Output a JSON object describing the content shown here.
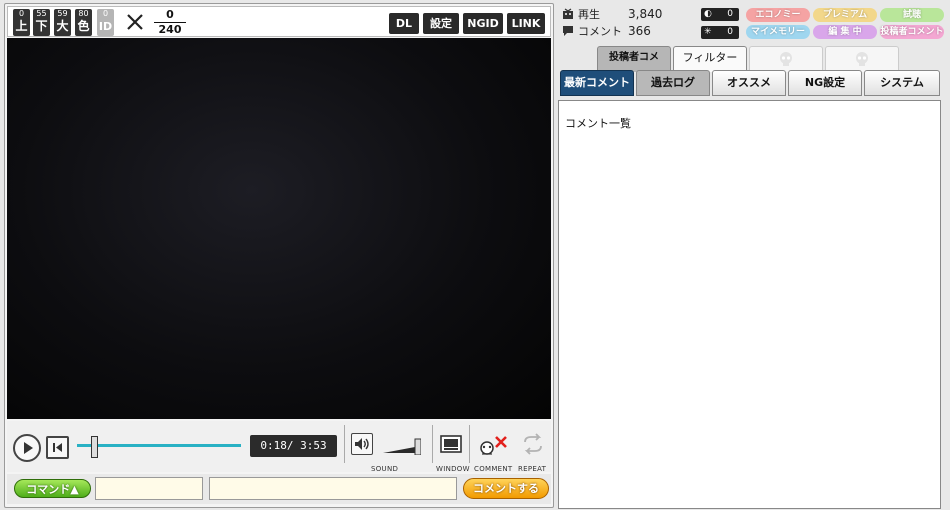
{
  "topbar": {
    "counters": [
      {
        "num": "0",
        "label": "上",
        "disabled": false
      },
      {
        "num": "55",
        "label": "下",
        "disabled": false
      },
      {
        "num": "59",
        "label": "大",
        "disabled": false
      },
      {
        "num": "80",
        "label": "色",
        "disabled": false
      },
      {
        "num": "0",
        "label": "ID",
        "disabled": true
      }
    ],
    "count_top": "0",
    "count_bottom": "240",
    "buttons": [
      "DL",
      "設定",
      "NGID",
      "LINK"
    ]
  },
  "player": {
    "time_display": "0:18/ 3:53",
    "seek_progress": 0.08,
    "volume_level": 1.0,
    "labels": {
      "sound": "SOUND",
      "window": "WINDOW",
      "comment": "COMMENT",
      "repeat": "REPEAT"
    }
  },
  "comment_bar": {
    "command_button": "コマンド▲",
    "command_value": "",
    "comment_value": "",
    "send_button": "コメントする"
  },
  "stats": {
    "views_label": "再生",
    "views_value": "3,840",
    "comments_label": "コメント",
    "comments_value": "366",
    "box1_value": "0",
    "box2_value": "0"
  },
  "badges": [
    {
      "label": "エコノミー",
      "color": "#f5a3a3"
    },
    {
      "label": "プレミアム",
      "color": "#f2d78a"
    },
    {
      "label": "試聴",
      "color": "#b9e69a"
    },
    {
      "label": "マイメモリー",
      "color": "#9fd6ef"
    },
    {
      "label": "編 集 中",
      "color": "#d9a6ea"
    },
    {
      "label": "投稿者コメント",
      "color": "#f3a7d2"
    }
  ],
  "upper_tabs": [
    "投稿者コメ",
    "フィルター"
  ],
  "lower_tabs": [
    "最新コメント",
    "過去ログ",
    "オススメ",
    "NG設定",
    "システム"
  ],
  "list_title": "コメント一覧",
  "colors": {
    "seek_bar": "#29b1c4",
    "active_tab": "#1f4e7a"
  }
}
